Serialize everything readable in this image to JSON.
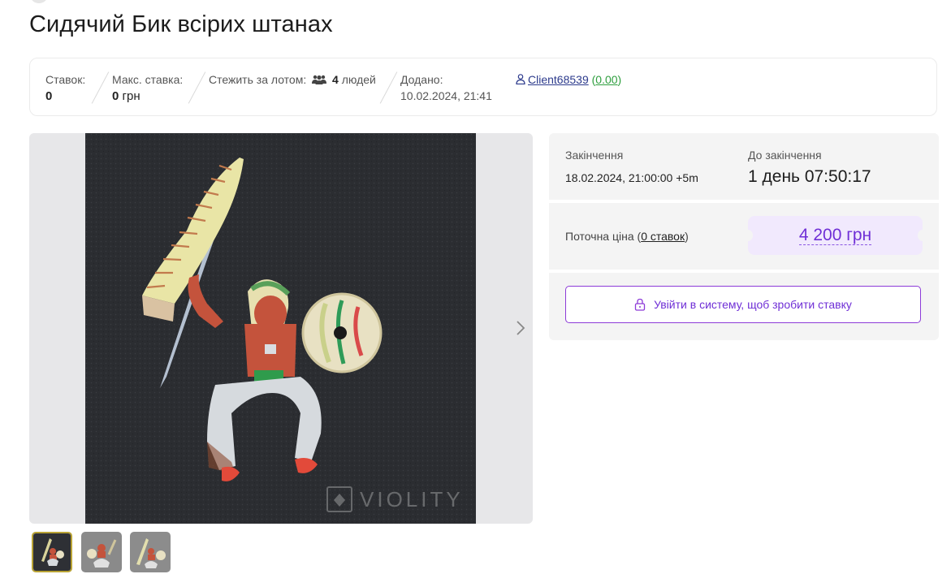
{
  "lot": {
    "title": "Сидячий Бик всірих штанах"
  },
  "stats": {
    "bids_label": "Ставок:",
    "bids_value": "0",
    "max_bid_label": "Макс. ставка:",
    "max_bid_value": "0",
    "max_bid_currency": "грн",
    "watch_label": "Стежить за лотом:",
    "watch_count": "4",
    "watch_suffix": "людей",
    "added_label": "Додано:",
    "added_value": "10.02.2024, 21:41",
    "seller_name": "Client68539",
    "seller_rating": "0.00"
  },
  "auction": {
    "end_label": "Закінчення",
    "end_value": "18.02.2024, 21:00:00 +5m",
    "remaining_label": "До закінчення",
    "remaining_value": "1 день 07:50:17",
    "current_price_label_pre": "Поточна ціна (",
    "current_price_bids": "0 ставок",
    "current_price_label_post": ")",
    "current_price": "4 200 грн",
    "login_button": "Увійти в систему, щоб зробити ставку"
  },
  "gallery": {
    "watermark": "VIOLITY",
    "thumbnail_count": 3,
    "active_thumbnail": 1
  },
  "icons": {
    "watchers": "people-group-icon",
    "seller": "user-icon",
    "next": "chevron-right-icon",
    "lock": "lock-icon"
  },
  "colors": {
    "accent": "#6f2fd6",
    "price_bg": "#f1e9fd",
    "link": "#2c3a8c",
    "rating": "#2e9e3e"
  }
}
